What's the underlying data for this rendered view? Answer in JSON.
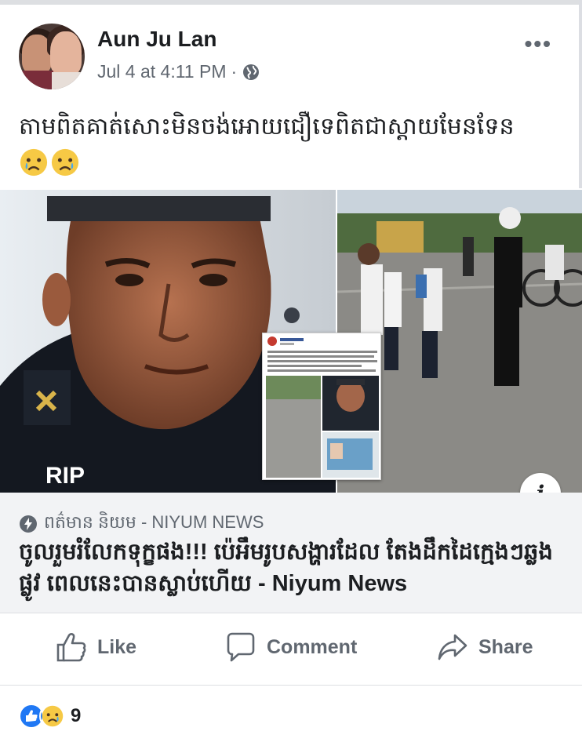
{
  "post": {
    "author": "Aun Ju Lan",
    "timestamp": "Jul 4 at 4:11 PM",
    "separator": "·",
    "privacy_icon": "globe-icon",
    "more_label": "•••",
    "text": "តាមពិតគាត់សោះមិនចង់អោយជឿទេពិតជាស្ដាយមែនទែន",
    "emojis": [
      "crying-face",
      "crying-face"
    ]
  },
  "media": {
    "left_caption": "RIP",
    "info_label": "i"
  },
  "link": {
    "source": "ពត៌មាន និយម - NIYUM NEWS",
    "headline": "ចូលរួមរំលែកទុក្ខផង!!! ប៉េអឹមរូបសង្ហារដែល តែងដឹកដៃក្មេងៗឆ្លងផ្លូវ ពេលនេះបានស្លាប់ហើយ - Niyum News"
  },
  "actions": {
    "like": "Like",
    "comment": "Comment",
    "share": "Share"
  },
  "reactions": {
    "types": [
      "like",
      "sad"
    ],
    "count": "9"
  },
  "colors": {
    "facebook_blue": "#2078f4",
    "text_secondary": "#606770",
    "link_bg": "#f2f3f5"
  }
}
